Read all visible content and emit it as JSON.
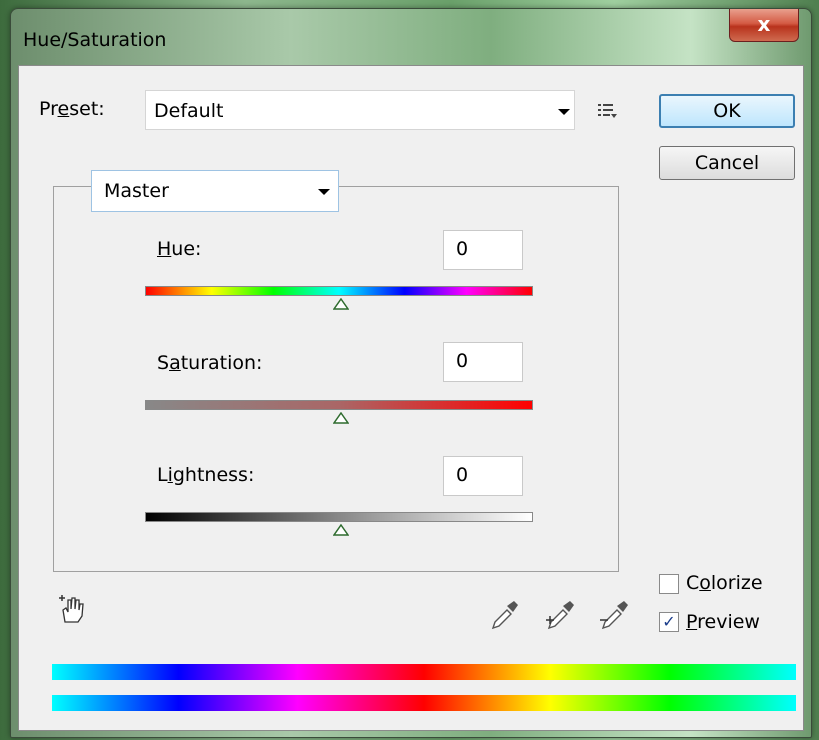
{
  "window": {
    "title": "Hue/Saturation",
    "close_label": "x"
  },
  "preset": {
    "label_pre": "Pr",
    "label_underline": "e",
    "label_post": "set:",
    "value": "Default"
  },
  "buttons": {
    "ok": "OK",
    "cancel": "Cancel"
  },
  "channel": {
    "value": "Master"
  },
  "hue": {
    "label_underline": "H",
    "label_rest": "ue:",
    "value": "0"
  },
  "saturation": {
    "label_pre": "S",
    "label_underline": "a",
    "label_rest": "turation:",
    "value": "0"
  },
  "lightness": {
    "label_pre": "L",
    "label_underline": "i",
    "label_rest": "ghtness:",
    "value": "0"
  },
  "options": {
    "colorize": {
      "label_pre": "C",
      "label_underline": "o",
      "label_rest": "lorize",
      "checked": false
    },
    "preview": {
      "label_underline": "P",
      "label_rest": "review",
      "checked": true,
      "check_glyph": "✓"
    }
  },
  "icons": [
    "close-icon",
    "preset-options-icon",
    "channel-dropdown-icon",
    "on-image-adjust-icon",
    "eyedropper-icon",
    "add-to-sample-eyedropper-icon",
    "subtract-from-sample-eyedropper-icon"
  ],
  "colors": {
    "accent": "#3c7fb1",
    "close": "#c9432a"
  }
}
